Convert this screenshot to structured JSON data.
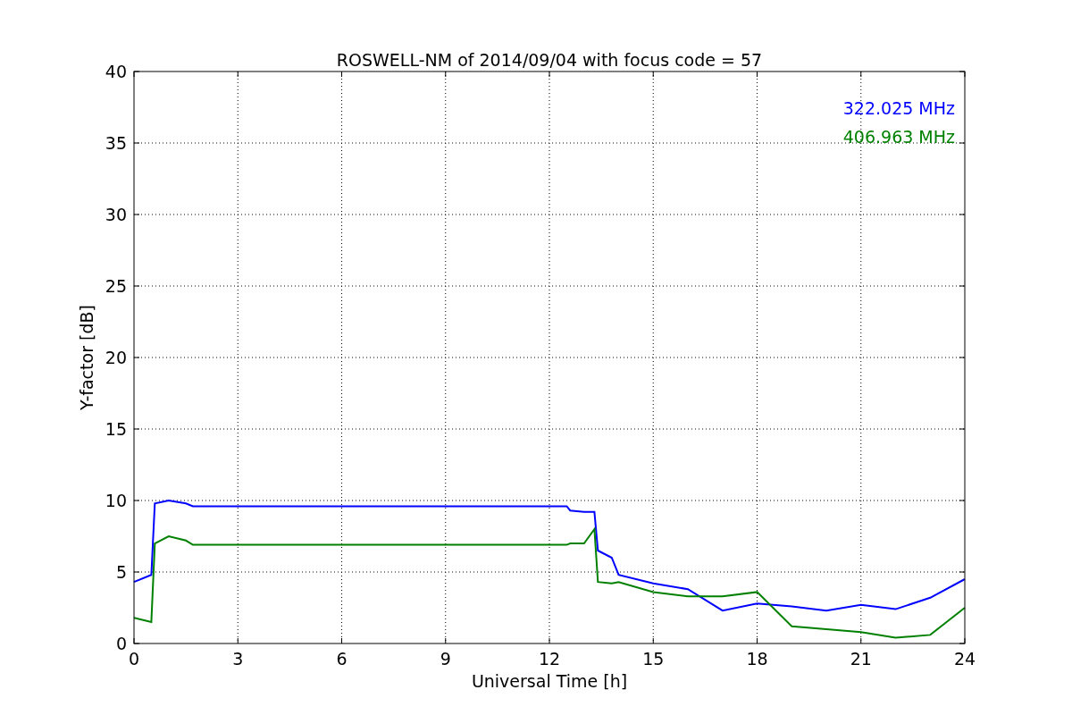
{
  "chart_data": {
    "type": "line",
    "title": "ROSWELL-NM of 2014/09/04 with focus code = 57",
    "xlabel": "Universal Time [h]",
    "ylabel": "Y-factor [dB]",
    "x": [
      0,
      0.5,
      0.6,
      1,
      1.5,
      1.7,
      12.5,
      12.6,
      13,
      13.3,
      13.4,
      13.8,
      14,
      15,
      16,
      17,
      18,
      19,
      20,
      21,
      22,
      23,
      24
    ],
    "series": [
      {
        "name": "322.025 MHz",
        "color": "#0000ff",
        "values": [
          4.3,
          4.8,
          9.8,
          10,
          9.8,
          9.6,
          9.6,
          9.3,
          9.2,
          9.2,
          6.5,
          6,
          4.8,
          4.2,
          3.8,
          2.3,
          2.8,
          2.6,
          2.3,
          2.7,
          2.4,
          3.2,
          4.5
        ]
      },
      {
        "name": "406.963 MHz",
        "color": "#008000",
        "values": [
          1.8,
          1.5,
          7,
          7.5,
          7.2,
          6.9,
          6.9,
          7,
          7,
          8,
          4.3,
          4.2,
          4.3,
          3.6,
          3.3,
          3.3,
          3.6,
          1.2,
          1.0,
          0.8,
          0.4,
          0.6,
          2.5
        ]
      }
    ],
    "grid": true,
    "xlim": [
      0,
      24
    ],
    "ylim": [
      0,
      40
    ],
    "xticks": [
      0,
      3,
      6,
      9,
      12,
      15,
      18,
      21,
      24
    ],
    "yticks": [
      0,
      5,
      10,
      15,
      20,
      25,
      30,
      35,
      40
    ]
  }
}
